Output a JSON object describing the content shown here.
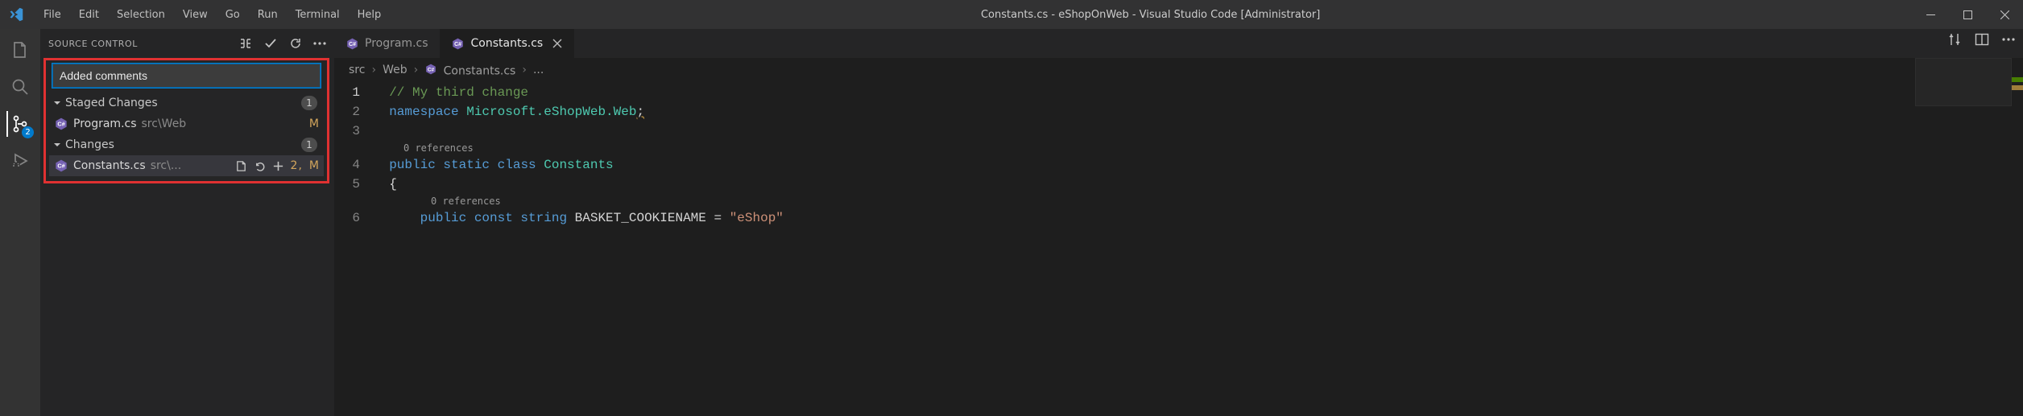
{
  "window": {
    "title": "Constants.cs - eShopOnWeb - Visual Studio Code [Administrator]"
  },
  "menu": {
    "file": "File",
    "edit": "Edit",
    "selection": "Selection",
    "view": "View",
    "go": "Go",
    "run": "Run",
    "terminal": "Terminal",
    "help": "Help"
  },
  "activity": {
    "scm_badge": "2"
  },
  "scm": {
    "panel_title": "SOURCE CONTROL",
    "commit_message": "Added comments",
    "staged": {
      "label": "Staged Changes",
      "count": "1",
      "items": [
        {
          "name": "Program.cs",
          "path": "src\\Web",
          "status": "M"
        }
      ]
    },
    "changes": {
      "label": "Changes",
      "count": "1",
      "items": [
        {
          "name": "Constants.cs",
          "path": "src\\...",
          "diff": "2,",
          "status": "M"
        }
      ]
    }
  },
  "tabs": {
    "inactive": "Program.cs",
    "active": "Constants.cs"
  },
  "breadcrumb": {
    "seg1": "src",
    "seg2": "Web",
    "seg3": "Constants.cs",
    "tail": "..."
  },
  "codelens": {
    "ref0a": "0 references",
    "ref0b": "0 references"
  },
  "code": {
    "l1_comment": "// My third change",
    "l2_kw": "namespace",
    "l2_ns": " Microsoft.eShopWeb.Web",
    "l2_semi": ";",
    "l4_kw1": "public",
    "l4_kw2": " static",
    "l4_kw3": " class",
    "l4_name": " Constants",
    "l5_open": "{",
    "l6_kw1": "public",
    "l6_kw2": " const",
    "l6_kw3": " string",
    "l6_id": " BASKET_COOKIENAME ",
    "l6_eq": "= ",
    "l6_str": "\"eShop\""
  },
  "linenums": {
    "n1": "1",
    "n2": "2",
    "n3": "3",
    "n4": "4",
    "n5": "5",
    "n6": "6"
  }
}
